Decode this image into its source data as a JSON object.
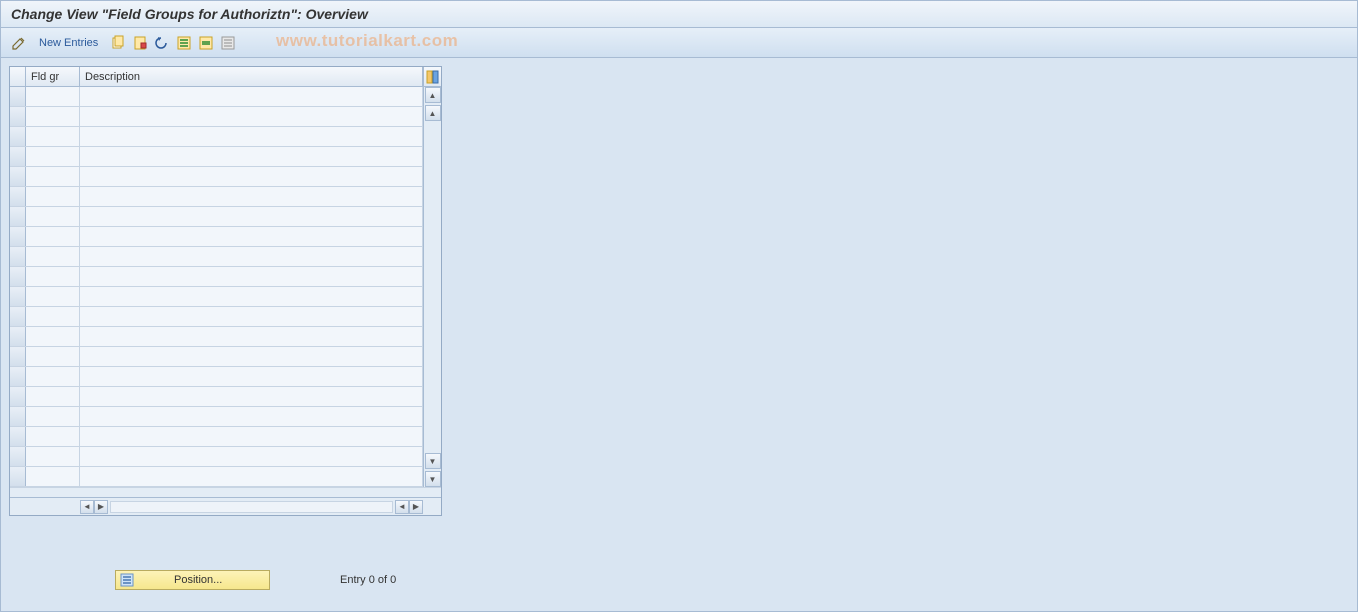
{
  "title": "Change View \"Field Groups for Authoriztn\": Overview",
  "toolbar": {
    "new_entries_label": "New Entries"
  },
  "grid": {
    "columns": {
      "fld_gr": "Fld gr",
      "description": "Description"
    },
    "row_count": 20,
    "rows": []
  },
  "footer": {
    "position_label": "Position...",
    "entry_text": "Entry 0 of 0"
  },
  "watermark": "www.tutorialkart.com",
  "icons": {
    "pencil": "pencil-icon",
    "copy": "copy-icon",
    "save": "save-icon",
    "undo": "undo-icon",
    "select_all": "select-all-icon",
    "select_block": "select-block-icon",
    "deselect": "deselect-icon",
    "config": "table-settings-icon"
  },
  "colors": {
    "background": "#d9e5f2",
    "border": "#a7bbd3",
    "highlight_button": "#f6e78d"
  }
}
